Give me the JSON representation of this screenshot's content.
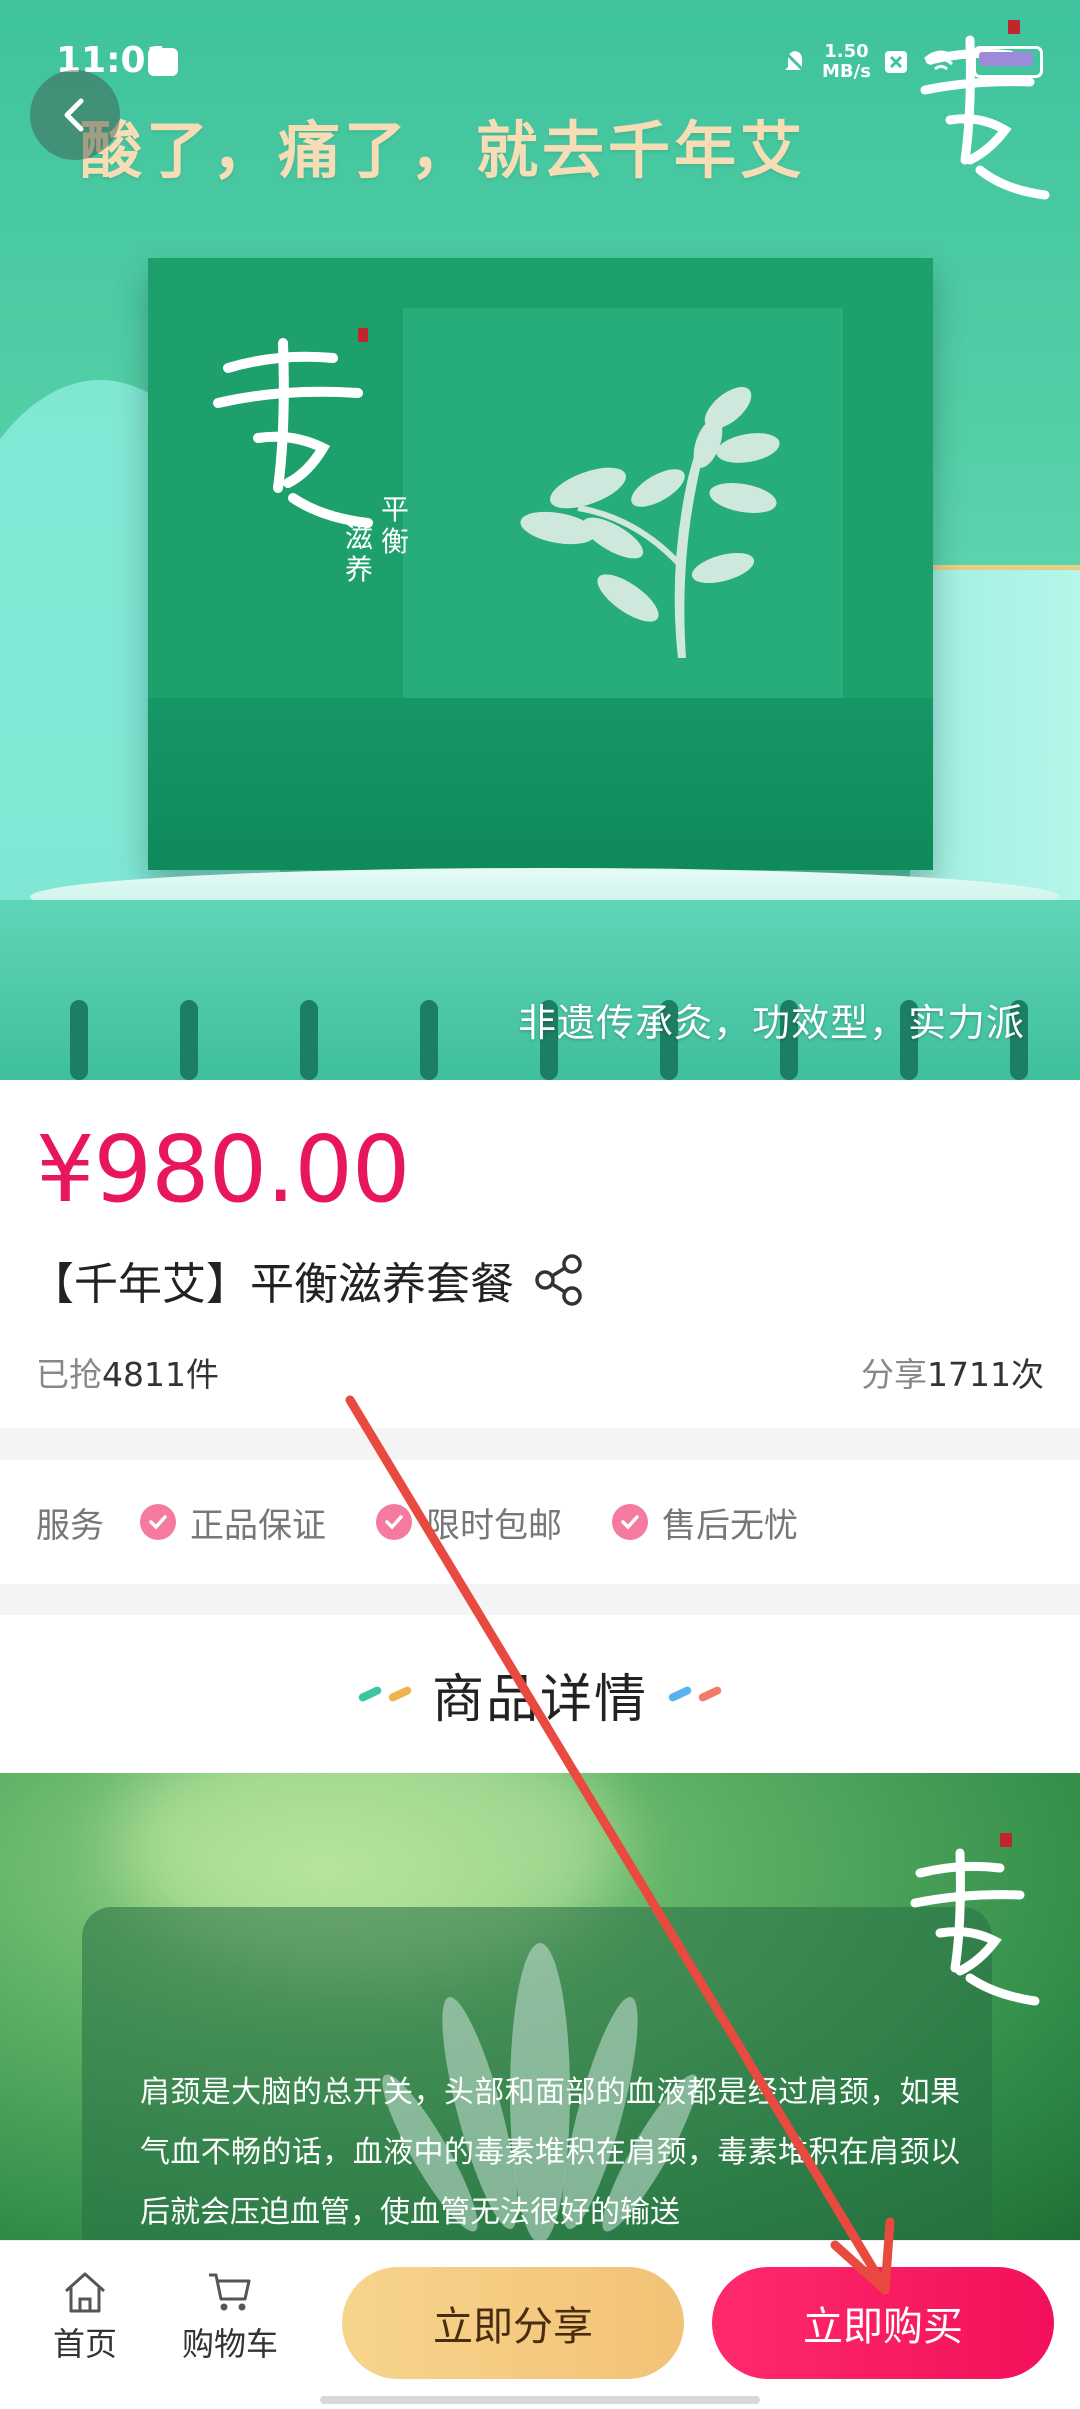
{
  "status_bar": {
    "time": "11:01",
    "speed_value": "1.50",
    "speed_unit": "MB/s"
  },
  "hero": {
    "headline": "酸了，痛了，就去千年艾",
    "box_sub_line1": "平",
    "box_sub_line2": "衡",
    "box_sub_line3": "滋",
    "box_sub_line4": "养",
    "slogan": "非遗传承灸，功效型，实力派"
  },
  "product": {
    "price": "¥980.00",
    "title": "【千年艾】平衡滋养套餐",
    "sold_prefix": "已抢",
    "sold_count": "4811",
    "sold_suffix": "件",
    "share_prefix": "分享",
    "share_count": "1711",
    "share_suffix": "次"
  },
  "services": {
    "label": "服务",
    "items": [
      "正品保证",
      "限时包邮",
      "售后无忧"
    ]
  },
  "details": {
    "heading": "商品详情",
    "paragraph": "肩颈是大脑的总开关，头部和面部的血液都是经过肩颈，如果气血不畅的话，血液中的毒素堆积在肩颈，毒素堆积在肩颈以后就会压迫血管，使血管无法很好的输送"
  },
  "bottom_bar": {
    "home_label": "首页",
    "cart_label": "购物车",
    "share_button": "立即分享",
    "buy_button": "立即购买"
  },
  "colors": {
    "price": "#e8175d",
    "buy_button": "#f2105a",
    "share_button": "#f4cd84",
    "annotation_arrow": "#e84a3f"
  }
}
